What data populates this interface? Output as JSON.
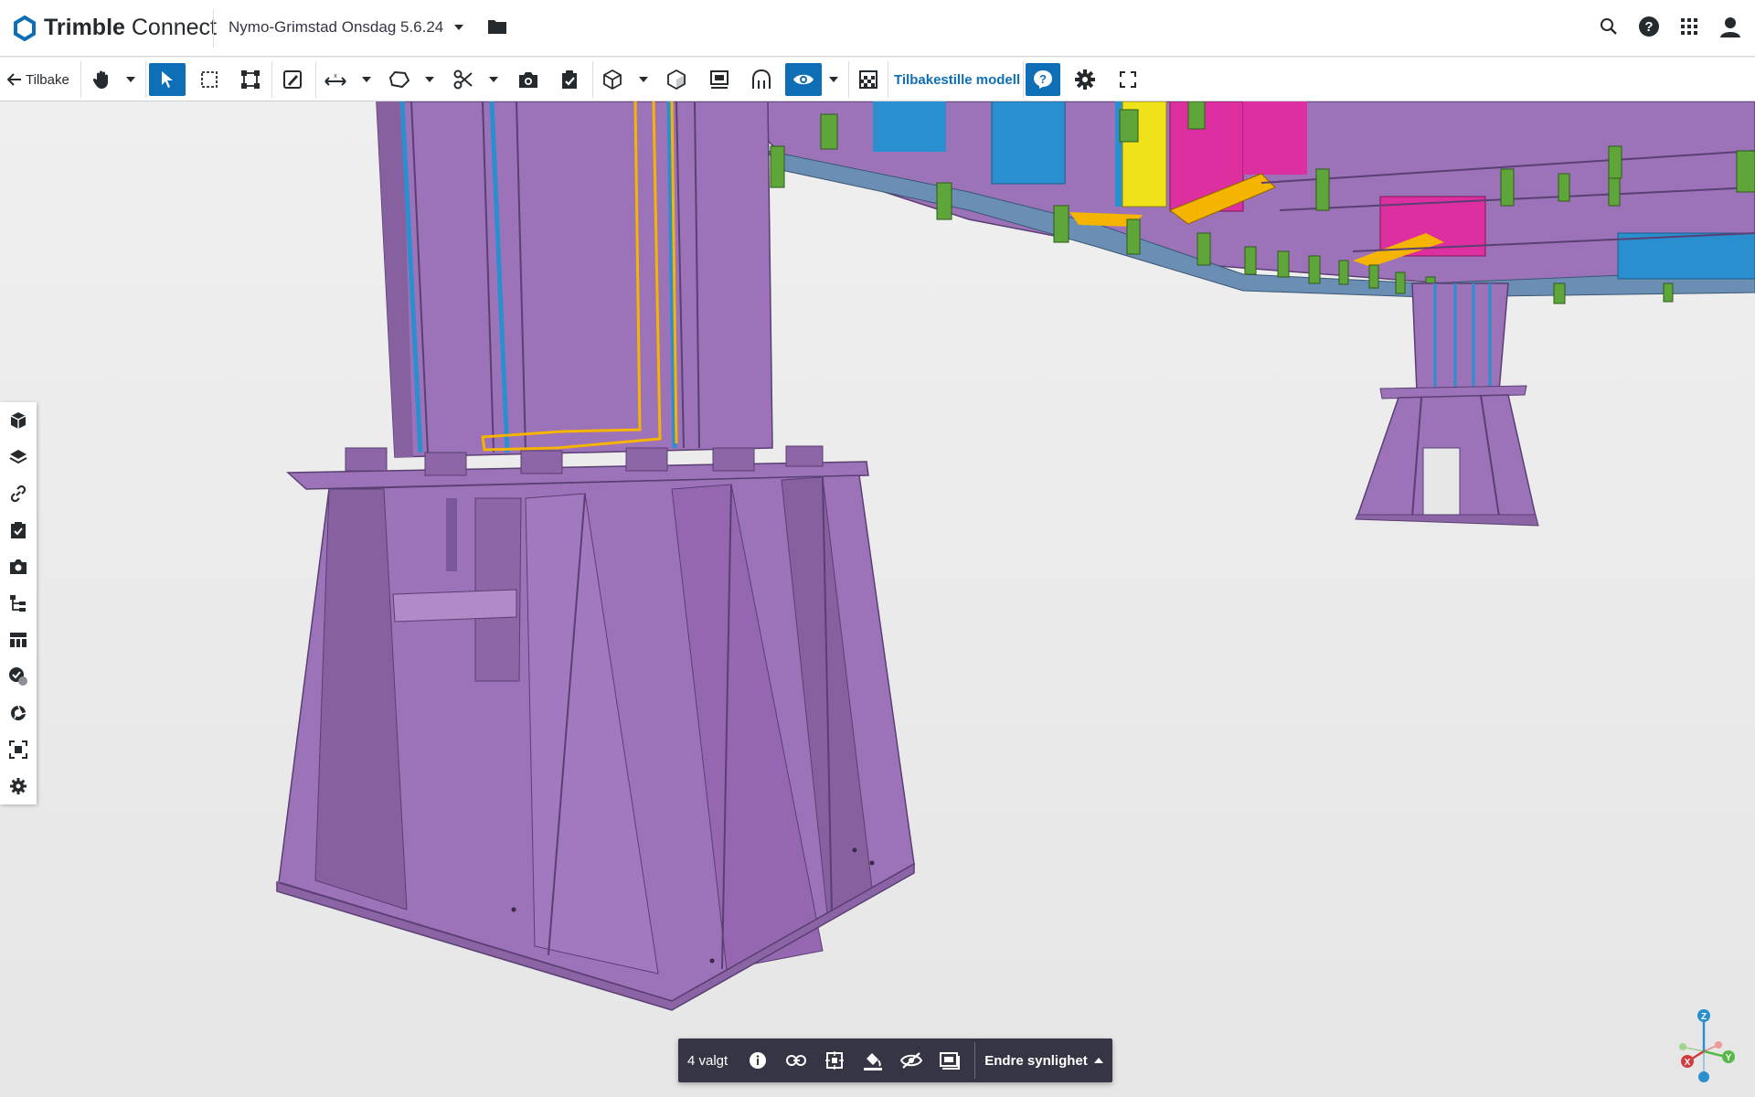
{
  "app": {
    "brand_light": "Trimble",
    "brand_bold": "Connect",
    "accent": "#0e6fb6"
  },
  "project": {
    "name": "Nymo-Grimstad Onsdag 5.6.24"
  },
  "toolbar": {
    "back_label": "Tilbake",
    "reset_label": "Tilbakestille modell"
  },
  "selection": {
    "count_label": "4 valgt",
    "visibility_label": "Endre synlighet"
  },
  "axes": {
    "z": "Z",
    "x": "X",
    "y": "Y"
  },
  "sidebar": {
    "items": [
      "models-icon",
      "layers-icon",
      "link-icon",
      "todo-icon",
      "views-icon",
      "hierarchy-icon",
      "table-icon",
      "clash-icon",
      "extensions-icon",
      "fit-icon",
      "settings-icon"
    ]
  },
  "colors": {
    "steel": "#9a6fb5",
    "selected_outline": "#f5b400",
    "secondary_beam": "#2a8fcf",
    "connection": "#5fa63a",
    "accent_magenta": "#dd2f9f",
    "accent_yellow": "#f0e21a"
  }
}
